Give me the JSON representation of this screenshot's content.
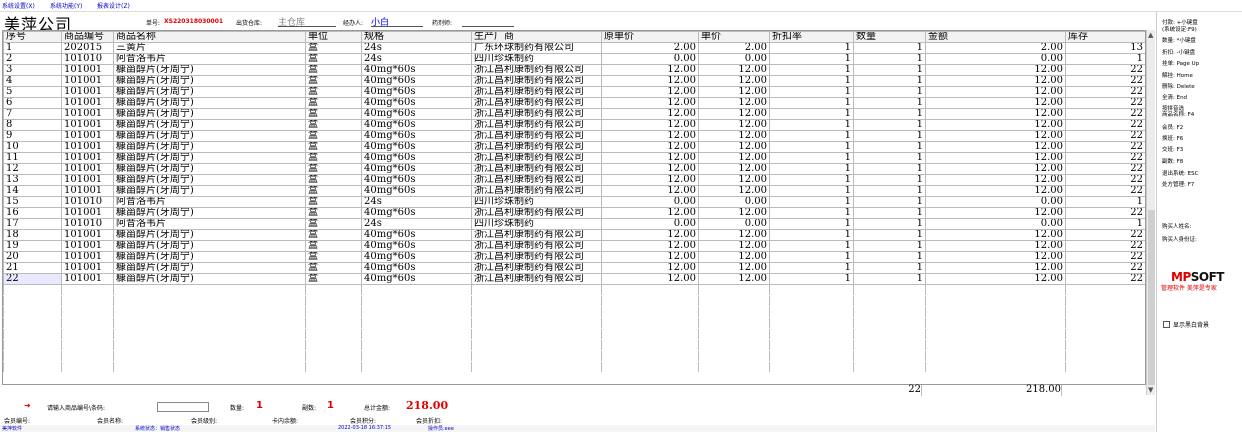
{
  "menu": [
    "系统设置(X)",
    "系统功能(Y)",
    "报表设计(Z)"
  ],
  "header": {
    "shop_name": "美萍公司",
    "order_no_label": "单号:",
    "order_no": "XS220318030001",
    "warehouse_label": "出货仓库:",
    "warehouse": "主仓库",
    "handler_label": "经办人:",
    "handler": "小白",
    "pharmacist_label": "药剂师:",
    "pharmacist": ""
  },
  "table": {
    "columns": [
      "序号",
      "商品编号",
      "商品名称",
      "单位",
      "规格",
      "生产厂商",
      "原单价",
      "单价",
      "折扣率",
      "数量",
      "金额",
      "库存"
    ],
    "rows": [
      [
        "1",
        "202015",
        "三黄片",
        "盒",
        "24s",
        "广东环球制药有限公司",
        "2.00",
        "2.00",
        "1",
        "1",
        "2.00",
        "13"
      ],
      [
        "2",
        "101010",
        "阿昔洛韦片",
        "盒",
        "24s",
        "四川珍珠制药",
        "0.00",
        "0.00",
        "1",
        "1",
        "0.00",
        "1"
      ],
      [
        "3",
        "101001",
        "糠甾醇片(牙周宁)",
        "盒",
        "40mg*60s",
        "浙江昌利康制药有限公司",
        "12.00",
        "12.00",
        "1",
        "1",
        "12.00",
        "22"
      ],
      [
        "4",
        "101001",
        "糠甾醇片(牙周宁)",
        "盒",
        "40mg*60s",
        "浙江昌利康制药有限公司",
        "12.00",
        "12.00",
        "1",
        "1",
        "12.00",
        "22"
      ],
      [
        "5",
        "101001",
        "糠甾醇片(牙周宁)",
        "盒",
        "40mg*60s",
        "浙江昌利康制药有限公司",
        "12.00",
        "12.00",
        "1",
        "1",
        "12.00",
        "22"
      ],
      [
        "6",
        "101001",
        "糠甾醇片(牙周宁)",
        "盒",
        "40mg*60s",
        "浙江昌利康制药有限公司",
        "12.00",
        "12.00",
        "1",
        "1",
        "12.00",
        "22"
      ],
      [
        "7",
        "101001",
        "糠甾醇片(牙周宁)",
        "盒",
        "40mg*60s",
        "浙江昌利康制药有限公司",
        "12.00",
        "12.00",
        "1",
        "1",
        "12.00",
        "22"
      ],
      [
        "8",
        "101001",
        "糠甾醇片(牙周宁)",
        "盒",
        "40mg*60s",
        "浙江昌利康制药有限公司",
        "12.00",
        "12.00",
        "1",
        "1",
        "12.00",
        "22"
      ],
      [
        "9",
        "101001",
        "糠甾醇片(牙周宁)",
        "盒",
        "40mg*60s",
        "浙江昌利康制药有限公司",
        "12.00",
        "12.00",
        "1",
        "1",
        "12.00",
        "22"
      ],
      [
        "10",
        "101001",
        "糠甾醇片(牙周宁)",
        "盒",
        "40mg*60s",
        "浙江昌利康制药有限公司",
        "12.00",
        "12.00",
        "1",
        "1",
        "12.00",
        "22"
      ],
      [
        "11",
        "101001",
        "糠甾醇片(牙周宁)",
        "盒",
        "40mg*60s",
        "浙江昌利康制药有限公司",
        "12.00",
        "12.00",
        "1",
        "1",
        "12.00",
        "22"
      ],
      [
        "12",
        "101001",
        "糠甾醇片(牙周宁)",
        "盒",
        "40mg*60s",
        "浙江昌利康制药有限公司",
        "12.00",
        "12.00",
        "1",
        "1",
        "12.00",
        "22"
      ],
      [
        "13",
        "101001",
        "糠甾醇片(牙周宁)",
        "盒",
        "40mg*60s",
        "浙江昌利康制药有限公司",
        "12.00",
        "12.00",
        "1",
        "1",
        "12.00",
        "22"
      ],
      [
        "14",
        "101001",
        "糠甾醇片(牙周宁)",
        "盒",
        "40mg*60s",
        "浙江昌利康制药有限公司",
        "12.00",
        "12.00",
        "1",
        "1",
        "12.00",
        "22"
      ],
      [
        "15",
        "101010",
        "阿昔洛韦片",
        "盒",
        "24s",
        "四川珍珠制药",
        "0.00",
        "0.00",
        "1",
        "1",
        "0.00",
        "1"
      ],
      [
        "16",
        "101001",
        "糠甾醇片(牙周宁)",
        "盒",
        "40mg*60s",
        "浙江昌利康制药有限公司",
        "12.00",
        "12.00",
        "1",
        "1",
        "12.00",
        "22"
      ],
      [
        "17",
        "101010",
        "阿昔洛韦片",
        "盒",
        "24s",
        "四川珍珠制药",
        "0.00",
        "0.00",
        "1",
        "1",
        "0.00",
        "1"
      ],
      [
        "18",
        "101001",
        "糠甾醇片(牙周宁)",
        "盒",
        "40mg*60s",
        "浙江昌利康制药有限公司",
        "12.00",
        "12.00",
        "1",
        "1",
        "12.00",
        "22"
      ],
      [
        "19",
        "101001",
        "糠甾醇片(牙周宁)",
        "盒",
        "40mg*60s",
        "浙江昌利康制药有限公司",
        "12.00",
        "12.00",
        "1",
        "1",
        "12.00",
        "22"
      ],
      [
        "20",
        "101001",
        "糠甾醇片(牙周宁)",
        "盒",
        "40mg*60s",
        "浙江昌利康制药有限公司",
        "12.00",
        "12.00",
        "1",
        "1",
        "12.00",
        "22"
      ],
      [
        "21",
        "101001",
        "糠甾醇片(牙周宁)",
        "盒",
        "40mg*60s",
        "浙江昌利康制药有限公司",
        "12.00",
        "12.00",
        "1",
        "1",
        "12.00",
        "22"
      ],
      [
        "22",
        "101001",
        "糠甾醇片(牙周宁)",
        "盒",
        "40mg*60s",
        "浙江昌利康制药有限公司",
        "12.00",
        "12.00",
        "1",
        "1",
        "12.00",
        "22"
      ]
    ],
    "selected_row": 21,
    "totals": {
      "qty": "22",
      "amount": "218.00"
    }
  },
  "bottom": {
    "arrow": "➜",
    "input_label": "请输入商品编号\\条码:",
    "input_value": "",
    "qty_label": "数量:",
    "qty": "1",
    "doses_label": "副数:",
    "doses": "1",
    "total_label": "总计金额:",
    "total": "218.00",
    "member_no_label": "会员编号:",
    "member_name_label": "会员名称:",
    "member_level_label": "会员级别:",
    "card_balance_label": "卡内余额:",
    "member_points_label": "会员积分:",
    "member_discount_label": "会员折扣:"
  },
  "status": {
    "company": "美萍软件",
    "state": "系统状态：销售状态",
    "datetime": "2022-03-18 16:37:15",
    "operator": "操作员:eee"
  },
  "side": {
    "hotkeys": [
      "付款: +小键盘",
      "(系统设定:F9)",
      "数量: *小键盘",
      "折扣: -小键盘",
      "挂单: Page Up",
      "解挂: Home",
      "删除: Delete",
      "全清: End",
      "按拼音选",
      "商品名称: F4",
      "会员: F2",
      "换班: F6",
      "交班: F3",
      "副数: F8",
      "退出系统: ESC",
      "处方管理: F7"
    ],
    "buyer_name_label": "购买人姓名:",
    "buyer_id_label": "购买人身份证:",
    "logo_a": "MP",
    "logo_b": "SOFT",
    "tagline": "管理软件 美萍是专家",
    "bw_bg_label": "显示黑白背景"
  }
}
